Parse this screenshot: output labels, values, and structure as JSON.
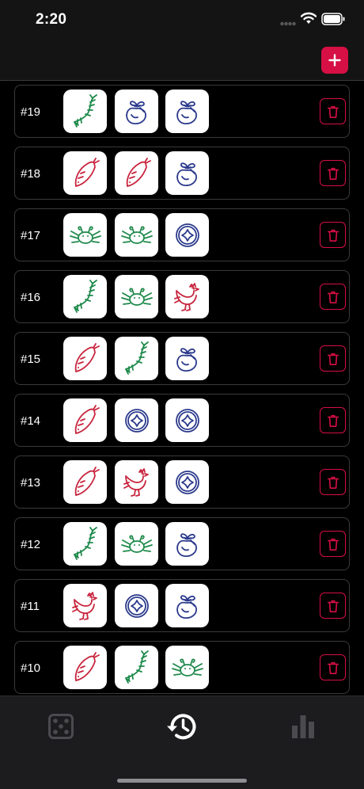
{
  "status_bar": {
    "time": "2:20"
  },
  "colors": {
    "accent": "#d60f44",
    "red_symbol": "#c8243d",
    "green_symbol": "#1f8a4c",
    "blue_symbol": "#2b3a8c"
  },
  "history": [
    {
      "label": "#19",
      "symbols": [
        "shrimp",
        "gourd",
        "gourd"
      ]
    },
    {
      "label": "#18",
      "symbols": [
        "fish",
        "fish",
        "gourd"
      ]
    },
    {
      "label": "#17",
      "symbols": [
        "crab",
        "crab",
        "coin"
      ]
    },
    {
      "label": "#16",
      "symbols": [
        "shrimp",
        "crab",
        "rooster"
      ]
    },
    {
      "label": "#15",
      "symbols": [
        "fish",
        "shrimp",
        "gourd"
      ]
    },
    {
      "label": "#14",
      "symbols": [
        "fish",
        "coin",
        "coin"
      ]
    },
    {
      "label": "#13",
      "symbols": [
        "fish",
        "rooster",
        "coin"
      ]
    },
    {
      "label": "#12",
      "symbols": [
        "shrimp",
        "crab",
        "gourd"
      ]
    },
    {
      "label": "#11",
      "symbols": [
        "rooster",
        "coin",
        "gourd"
      ]
    },
    {
      "label": "#10",
      "symbols": [
        "fish",
        "shrimp",
        "crab"
      ]
    }
  ],
  "tabs": [
    {
      "icon": "dice-icon",
      "active": false
    },
    {
      "icon": "history-icon",
      "active": true
    },
    {
      "icon": "bar-chart-icon",
      "active": false
    }
  ]
}
